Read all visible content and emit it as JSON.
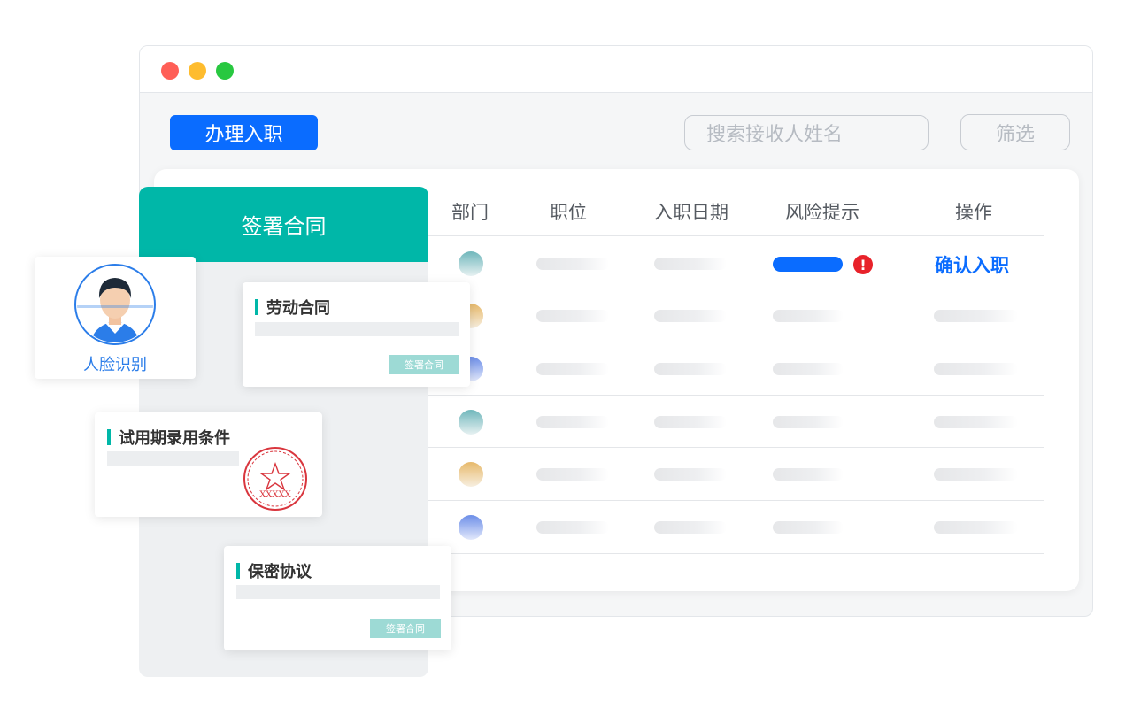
{
  "window": {
    "controls": [
      {
        "name": "close",
        "color": "#ff5f57"
      },
      {
        "name": "minimize",
        "color": "#febc2e"
      },
      {
        "name": "maximize",
        "color": "#28c840"
      }
    ]
  },
  "toolbar": {
    "primary_button": "办理入职",
    "search_placeholder": "搜索接收人姓名",
    "filter_button": "筛选"
  },
  "table": {
    "headers": [
      "部门",
      "职位",
      "入职日期",
      "风险提示",
      "操作"
    ],
    "rows": [
      {
        "avatar_color": "#6fb7bb",
        "risk": "high",
        "action": "确认入职"
      },
      {
        "avatar_color": "#e7b96b",
        "risk": "none",
        "action": ""
      },
      {
        "avatar_color": "#6c8ee8",
        "risk": "none",
        "action": ""
      },
      {
        "avatar_color": "#6fb7bb",
        "risk": "none",
        "action": ""
      },
      {
        "avatar_color": "#e7b96b",
        "risk": "none",
        "action": ""
      },
      {
        "avatar_color": "#6c8ee8",
        "risk": "none",
        "action": ""
      }
    ]
  },
  "sign_panel": {
    "title": "签署合同",
    "documents": [
      {
        "title": "劳动合同",
        "button": "签署合同"
      },
      {
        "title": "试用期录用条件",
        "seal": "stamp-icon",
        "seal_text": "XXXXX"
      },
      {
        "title": "保密协议",
        "button": "签署合同"
      }
    ]
  },
  "face_recognition": {
    "label": "人脸识别",
    "icon": "face-avatar-icon"
  },
  "colors": {
    "primary": "#0a6cff",
    "teal": "#00b7a8",
    "teal_light": "#9ddad5",
    "link": "#0a6cff",
    "alert": "#e8222a",
    "seal": "#d9363e",
    "face_blue": "#2b7de9"
  }
}
